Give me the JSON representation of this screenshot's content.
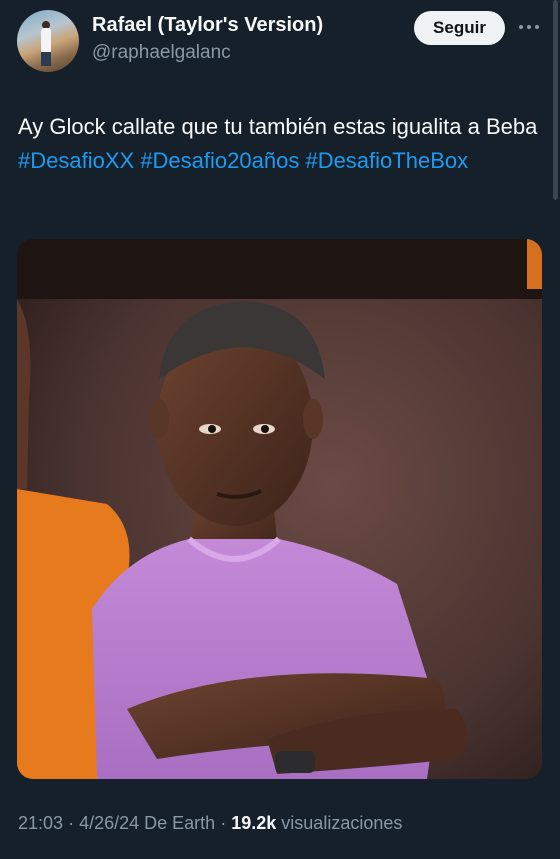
{
  "tweet": {
    "author": {
      "display_name": "Rafael (Taylor's Version)",
      "handle": "@raphaelgalanc"
    },
    "follow_label": "Seguir",
    "more_icon": "more-horizontal-icon",
    "text_plain": "Ay Glock callate que tu también estas igualita a Beba",
    "hashtags": [
      "#DesafioXX",
      "#Desafio20años",
      "#DesafioTheBox"
    ],
    "time": "21:03",
    "date": "4/26/24",
    "separator": "·",
    "source": "De Earth",
    "views_count": "19.2k",
    "views_label": "visualizaciones"
  },
  "colors": {
    "background": "#15202b",
    "text": "#f7f9f9",
    "secondary_text": "#8b98a5",
    "link": "#1d9bf0",
    "follow_button_bg": "#eff3f4"
  }
}
